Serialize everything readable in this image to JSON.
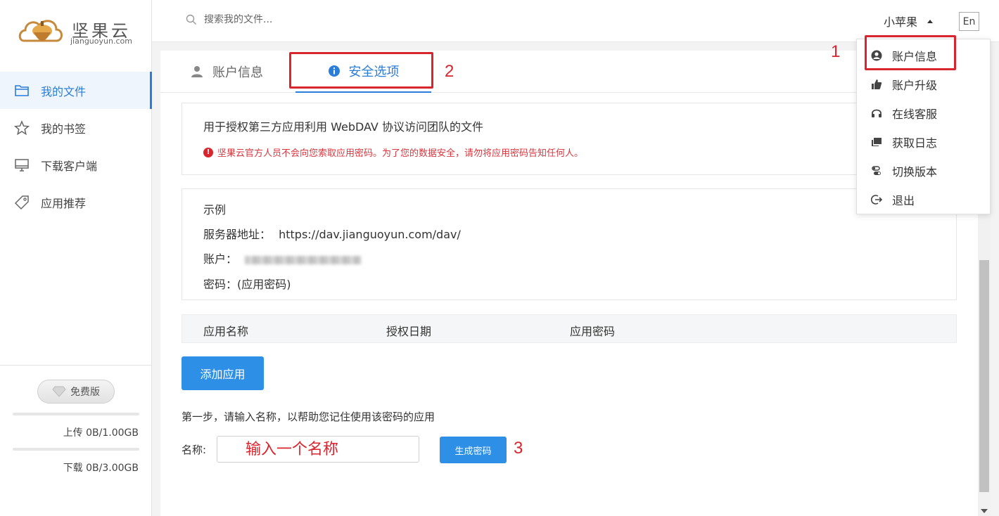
{
  "brand": {
    "name": "坚果云",
    "domain": "jianguoyun.com"
  },
  "sidebar": {
    "items": [
      {
        "label": "我的文件",
        "icon": "folder-icon",
        "active": true
      },
      {
        "label": "我的书签",
        "icon": "star-icon"
      },
      {
        "label": "下载客户端",
        "icon": "monitor-icon"
      },
      {
        "label": "应用推荐",
        "icon": "tag-icon"
      }
    ],
    "plan_label": "免费版",
    "upload_quota": "上传 0B/1.00GB",
    "download_quota": "下载 0B/3.00GB"
  },
  "header": {
    "search_placeholder": "搜索我的文件...",
    "user_name": "小苹果",
    "lang_button": "En"
  },
  "tabs": [
    {
      "label": "账户信息",
      "icon": "user-icon"
    },
    {
      "label": "安全选项",
      "icon": "info-icon",
      "active": true
    }
  ],
  "content": {
    "description": "用于授权第三方应用利用 WebDAV 协议访问团队的文件",
    "warning": "坚果云官方人员不会向您索取应用密码。为了您的数据安全，请勿将应用密码告知任何人。",
    "example": {
      "title": "示例",
      "server_label": "服务器地址：",
      "server_value": "https://dav.jianguoyun.com/dav/",
      "account_label": "账户：",
      "password_label": "密码：(应用密码)"
    },
    "table_headers": [
      "应用名称",
      "授权日期",
      "应用密码"
    ],
    "add_app_button": "添加应用",
    "step_text": "第一步，请输入名称，以帮助您记住使用该密码的应用",
    "name_label": "名称:",
    "name_input_placeholder": "输入一个名称",
    "generate_button": "生成密码"
  },
  "dropdown": {
    "items": [
      {
        "label": "账户信息",
        "icon": "account-circle-icon"
      },
      {
        "label": "账户升级",
        "icon": "thumbs-up-icon"
      },
      {
        "label": "在线客服",
        "icon": "headset-icon"
      },
      {
        "label": "获取日志",
        "icon": "message-icon"
      },
      {
        "label": "切换版本",
        "icon": "toggle-icon"
      },
      {
        "label": "退出",
        "icon": "logout-icon"
      }
    ]
  },
  "annotations": [
    "1",
    "2",
    "3"
  ],
  "colors": {
    "accent": "#2a7dd8",
    "annotation": "#d9262e",
    "warning": "#d9363e"
  }
}
